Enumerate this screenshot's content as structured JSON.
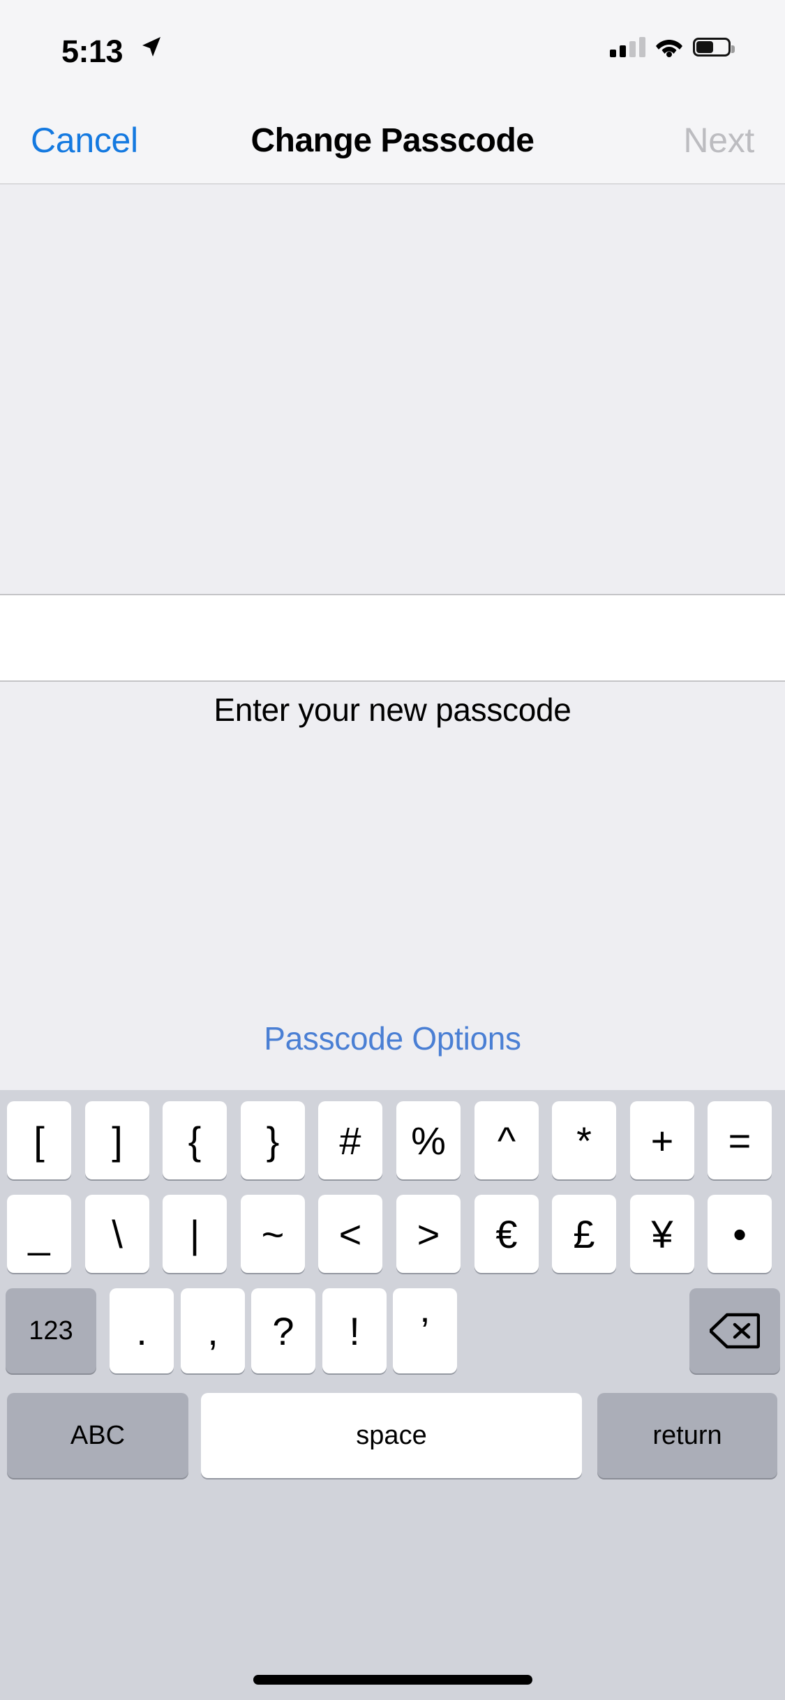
{
  "status_bar": {
    "time": "5:13",
    "location_icon": "location-arrow-icon",
    "signal_icon": "cellular-signal-icon",
    "signal_bars_filled": 2,
    "signal_bars_total": 4,
    "wifi_icon": "wifi-icon",
    "battery_icon": "battery-icon",
    "battery_percent": 50
  },
  "nav_bar": {
    "cancel_label": "Cancel",
    "title": "Change Passcode",
    "next_label": "Next",
    "next_enabled": false,
    "cancel_color": "#1479e0",
    "next_color": "#bcbcc0"
  },
  "main": {
    "prompt": "Enter your new passcode",
    "passcode_value": "",
    "passcode_placeholder": "",
    "passcode_options_label": "Passcode Options",
    "passcode_options_color": "#4a7fd4",
    "background_color": "#eeeef2"
  },
  "keyboard": {
    "layout": "symbols",
    "background_color": "#d1d3da",
    "key_color": "#ffffff",
    "modifier_key_color": "#abaeb8",
    "row1": [
      "[",
      "]",
      "{",
      "}",
      "#",
      "%",
      "^",
      "*",
      "+",
      "="
    ],
    "row2": [
      "_",
      "\\",
      "|",
      "~",
      "<",
      ">",
      "€",
      "£",
      "¥",
      "•"
    ],
    "row3": {
      "numeric_switch_label": "123",
      "keys": [
        ".",
        ",",
        "?",
        "!",
        "’"
      ],
      "backspace_icon": "backspace-icon"
    },
    "row4": {
      "letters_switch_label": "ABC",
      "space_label": "space",
      "return_label": "return"
    }
  },
  "home_indicator": "home-indicator"
}
